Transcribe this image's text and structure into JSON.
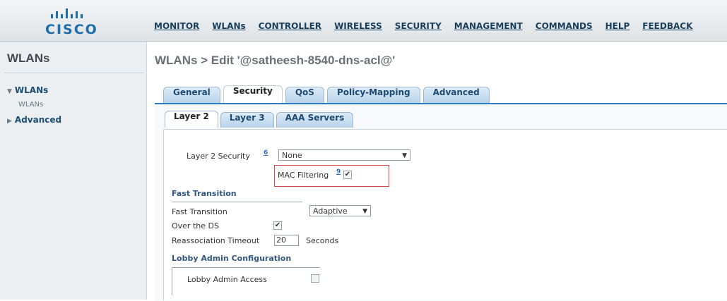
{
  "header": {
    "logo_text": "CISCO",
    "nav": [
      "MONITOR",
      "WLANs",
      "CONTROLLER",
      "WIRELESS",
      "SECURITY",
      "MANAGEMENT",
      "COMMANDS",
      "HELP",
      "FEEDBACK"
    ]
  },
  "sidebar": {
    "title": "WLANs",
    "items": [
      {
        "label": "WLANs",
        "expanded": true,
        "sub": "WLANs"
      },
      {
        "label": "Advanced",
        "expanded": false
      }
    ],
    "icons": {
      "expanded": "triangle-down-icon",
      "collapsed": "triangle-right-icon"
    }
  },
  "breadcrumb": "WLANs > Edit  '@satheesh-8540-dns-acl@'",
  "tabs": [
    "General",
    "Security",
    "QoS",
    "Policy-Mapping",
    "Advanced"
  ],
  "active_tab": "Security",
  "subtabs": [
    "Layer 2",
    "Layer 3",
    "AAA Servers"
  ],
  "active_subtab": "Layer 2",
  "form": {
    "layer2_security_label": "Layer 2 Security",
    "layer2_security_help": "6",
    "layer2_security_value": "None",
    "mac_filtering_label": "MAC Filtering",
    "mac_filtering_help": "9",
    "mac_filtering_checked": true,
    "fast_transition_section": "Fast Transition",
    "fast_transition_label": "Fast Transition",
    "fast_transition_value": "Adaptive",
    "over_the_ds_label": "Over the DS",
    "over_the_ds_checked": true,
    "reassoc_label": "Reassociation Timeout",
    "reassoc_value": "20",
    "reassoc_unit": "Seconds",
    "lobby_section": "Lobby Admin Configuration",
    "lobby_access_label": "Lobby Admin Access",
    "lobby_access_checked": false
  },
  "colors": {
    "accent": "#2f7dc2",
    "highlight": "#d44a4a",
    "brand": "#1f6ea8"
  }
}
